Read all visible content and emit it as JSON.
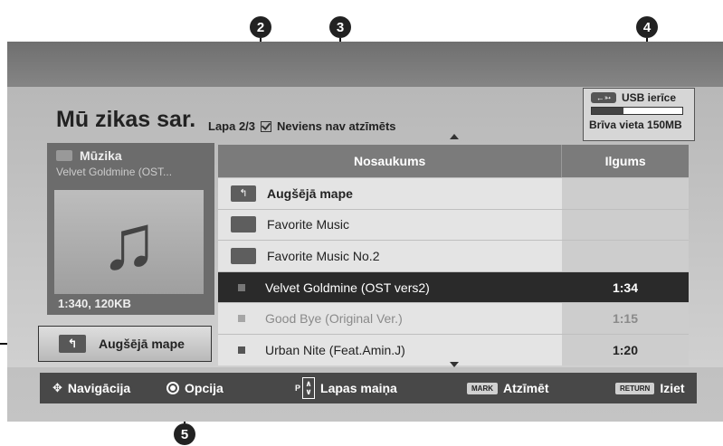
{
  "callouts": [
    "2",
    "3",
    "4",
    "5"
  ],
  "page": {
    "title": "Mū zikas sar.",
    "page_status": "Lapa 2/3",
    "mark_status": "Neviens nav atzīmēts"
  },
  "usb": {
    "device": "USB ierīce",
    "icon_label": "←➳",
    "free": "Brīva vieta 150MB",
    "used_fraction": 0.35
  },
  "now_playing": {
    "category": "Mūzika",
    "track": "Velvet Goldmine (OST...",
    "info": "1:340, 120KB"
  },
  "up_button": {
    "label": "Augšējā mape"
  },
  "table": {
    "columns": {
      "name": "Nosaukums",
      "duration": "Ilgums"
    },
    "rows": [
      {
        "type": "up",
        "name": "Augšējā mape",
        "duration": ""
      },
      {
        "type": "folder",
        "name": "Favorite Music",
        "duration": ""
      },
      {
        "type": "folder",
        "name": "Favorite Music No.2",
        "duration": ""
      },
      {
        "type": "file",
        "name": "Velvet Goldmine (OST vers2)",
        "duration": "1:34",
        "selected": true
      },
      {
        "type": "file",
        "name": "Good Bye (Original Ver.)",
        "duration": "1:15",
        "dim": true
      },
      {
        "type": "file",
        "name": "Urban Nite (Feat.Amin.J)",
        "duration": "1:20"
      }
    ]
  },
  "bottom": {
    "nav": "Navigācija",
    "option": "Opcija",
    "page_key": "P",
    "page_change": "Lapas maiņa",
    "mark_key": "MARK",
    "mark": "Atzīmēt",
    "return_key": "RETURN",
    "exit": "Iziet"
  }
}
